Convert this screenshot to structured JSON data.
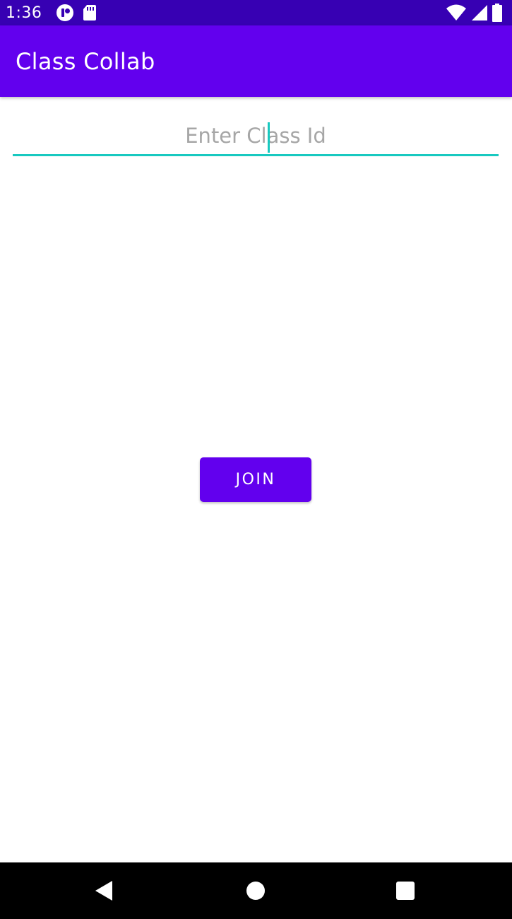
{
  "status_bar": {
    "time": "1:36",
    "icons_left": [
      "notification-app-icon",
      "sd-card-icon"
    ],
    "icons_right": [
      "wifi-icon",
      "cell-signal-icon",
      "battery-icon"
    ],
    "color": "#3700b3"
  },
  "app_bar": {
    "title": "Class Collab",
    "color": "#6200ee"
  },
  "class_id_input": {
    "value": "",
    "placeholder": "Enter Class Id",
    "accent_color": "#18c9c0"
  },
  "join_button": {
    "label": "JOIN",
    "color": "#6200ee"
  },
  "nav_bar": {
    "icons": [
      "back-icon",
      "home-icon",
      "recents-icon"
    ]
  }
}
